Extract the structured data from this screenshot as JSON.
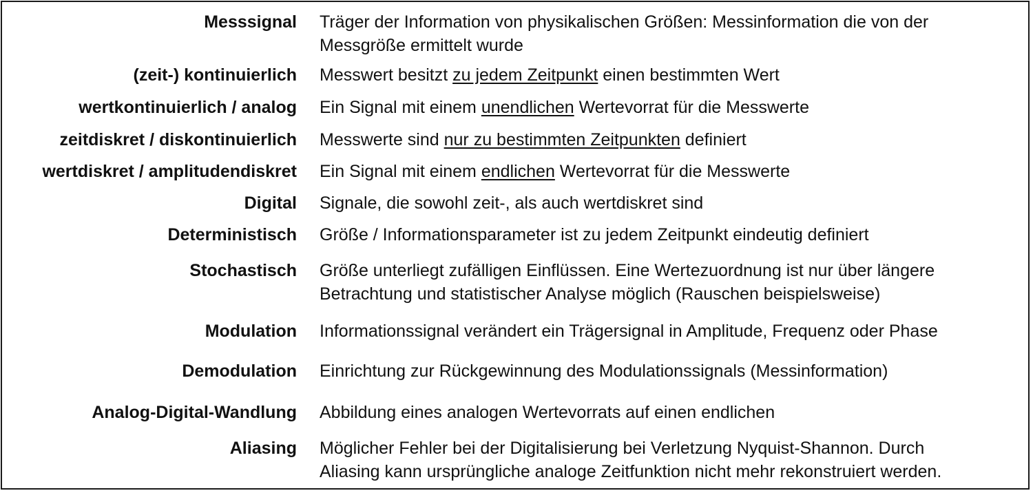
{
  "rows": [
    {
      "term": "Messsignal",
      "def_lines": [
        "Träger der Information von physikalischen Größen: Messinformation die von der",
        "Messgröße ermittelt wurde"
      ]
    },
    {
      "term": "(zeit-) kontinuierlich",
      "def_pre": "Messwert besitzt ",
      "def_u": "zu jedem Zeitpunkt",
      "def_post": " einen bestimmten Wert"
    },
    {
      "term": "wertkontinuierlich / analog",
      "def_pre": "Ein Signal mit einem ",
      "def_u": "unendlichen",
      "def_post": " Wertevorrat für die Messwerte"
    },
    {
      "term": "zeitdiskret / diskontinuierlich",
      "def_pre": "Messwerte sind ",
      "def_u": "nur zu bestimmten Zeitpunkten",
      "def_post": " definiert"
    },
    {
      "term": "wertdiskret / amplitudendiskret",
      "def_pre": "Ein Signal mit einem ",
      "def_u": "endlichen",
      "def_post": " Wertevorrat für die Messwerte"
    },
    {
      "term": "Digital",
      "def_lines": [
        "Signale, die sowohl zeit-, als auch wertdiskret sind"
      ]
    },
    {
      "term": "Deterministisch",
      "def_lines": [
        "Größe / Informationsparameter ist zu jedem Zeitpunkt eindeutig definiert"
      ]
    },
    {
      "term": "Stochastisch",
      "def_lines": [
        "Größe unterliegt zufälligen Einflüssen. Eine Wertezuordnung ist nur über längere",
        "Betrachtung und statistischer Analyse möglich (Rauschen beispielsweise)"
      ]
    },
    {
      "term": "Modulation",
      "def_lines": [
        "Informationssignal verändert ein Trägersignal in Amplitude, Frequenz oder Phase"
      ]
    },
    {
      "term": "Demodulation",
      "def_lines": [
        "Einrichtung zur Rückgewinnung des Modulationssignals (Messinformation)"
      ]
    },
    {
      "term": "Analog-Digital-Wandlung",
      "def_lines": [
        "Abbildung eines analogen Wertevorrats auf einen endlichen"
      ]
    },
    {
      "term": "Aliasing",
      "def_lines": [
        "Möglicher Fehler bei der Digitalisierung bei Verletzung Nyquist-Shannon. Durch",
        "Aliasing kann ursprüngliche analoge Zeitfunktion nicht mehr rekonstruiert werden."
      ]
    }
  ]
}
